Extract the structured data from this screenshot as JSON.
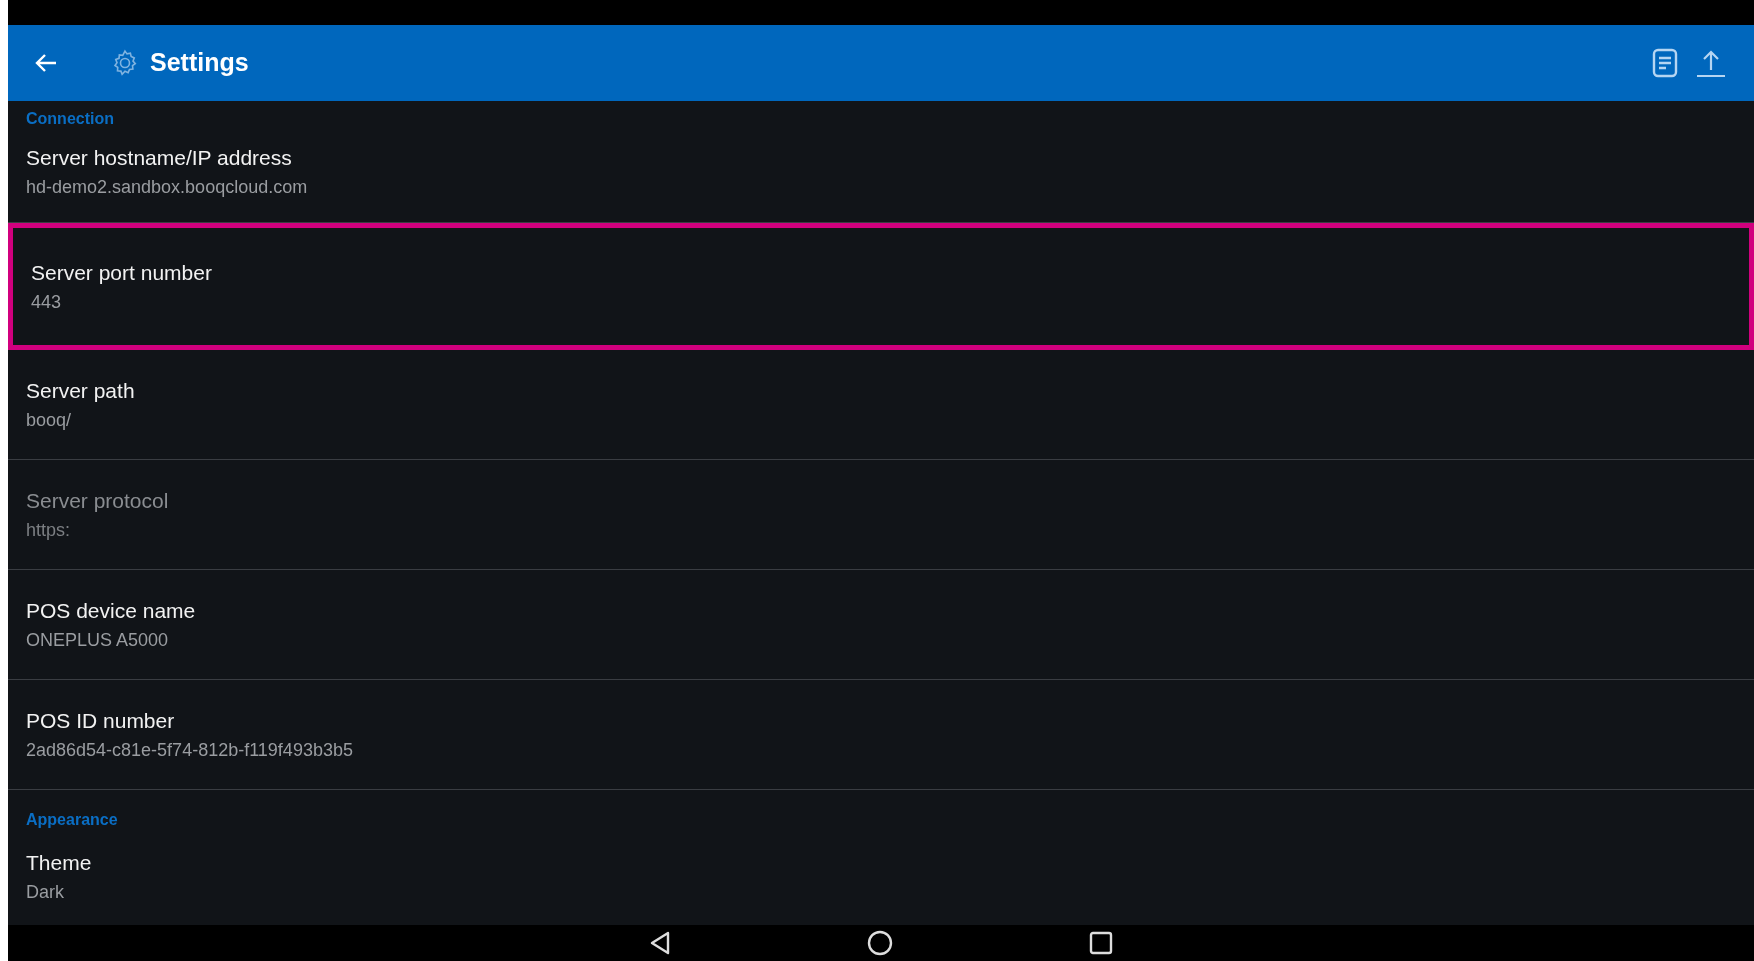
{
  "app_bar": {
    "title": "Settings"
  },
  "items": [
    {
      "kind": "header",
      "title": "Connection"
    },
    {
      "kind": "preference",
      "title": "Server hostname/IP address",
      "summary": "hd-demo2.sandbox.booqcloud.com",
      "disabled": false,
      "highlighted": false
    },
    {
      "kind": "preference",
      "title": "Server port number",
      "summary": "443",
      "disabled": false,
      "highlighted": true
    },
    {
      "kind": "preference",
      "title": "Server path",
      "summary": "booq/",
      "disabled": false,
      "highlighted": false
    },
    {
      "kind": "preference",
      "title": "Server protocol",
      "summary": "https:",
      "disabled": true,
      "highlighted": false
    },
    {
      "kind": "preference",
      "title": "POS device name",
      "summary": "ONEPLUS A5000",
      "disabled": false,
      "highlighted": false
    },
    {
      "kind": "preference",
      "title": "POS ID number",
      "summary": "2ad86d54-c81e-5f74-812b-f119f493b3b5",
      "disabled": false,
      "highlighted": false
    },
    {
      "kind": "header",
      "title": "Appearance"
    },
    {
      "kind": "preference",
      "title": "Theme",
      "summary": "Dark",
      "disabled": false,
      "highlighted": false
    }
  ]
}
